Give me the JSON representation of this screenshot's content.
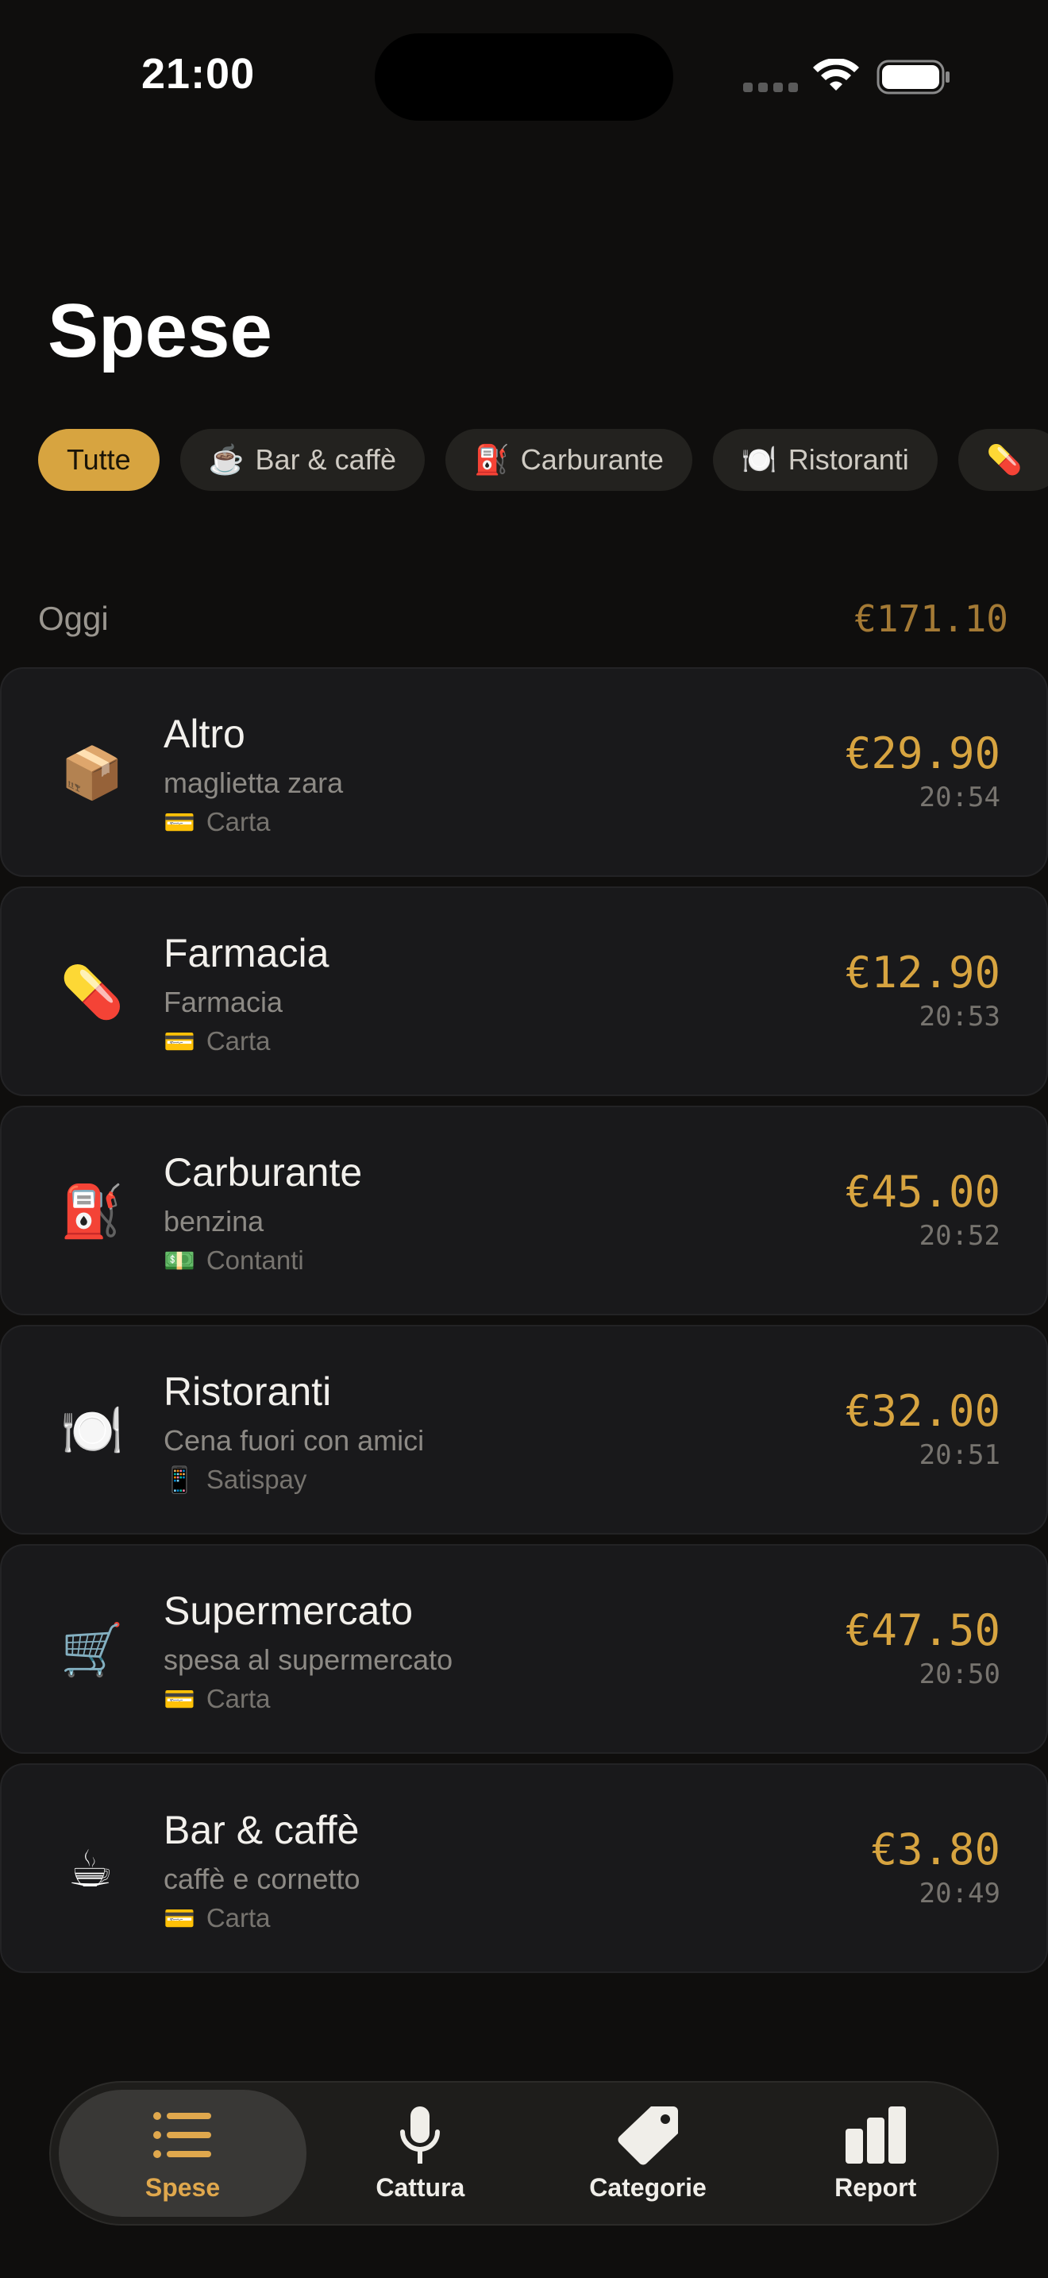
{
  "status_bar": {
    "time": "21:00"
  },
  "page": {
    "title": "Spese"
  },
  "filters": [
    {
      "label": "Tutte",
      "icon": "",
      "active": true
    },
    {
      "label": "Bar & caffè",
      "icon": "☕",
      "active": false
    },
    {
      "label": "Carburante",
      "icon": "⛽",
      "active": false
    },
    {
      "label": "Ristoranti",
      "icon": "🍽️",
      "active": false
    },
    {
      "label": "",
      "icon": "💊",
      "active": false
    }
  ],
  "section": {
    "title": "Oggi",
    "total": "€171.10"
  },
  "expenses": [
    {
      "icon": "📦",
      "category": "Altro",
      "note": "maglietta zara",
      "method_icon": "💳",
      "method": "Carta",
      "amount": "€29.90",
      "time": "20:54"
    },
    {
      "icon": "💊",
      "category": "Farmacia",
      "note": "Farmacia",
      "method_icon": "💳",
      "method": "Carta",
      "amount": "€12.90",
      "time": "20:53"
    },
    {
      "icon": "⛽",
      "category": "Carburante",
      "note": "benzina",
      "method_icon": "💵",
      "method": "Contanti",
      "amount": "€45.00",
      "time": "20:52"
    },
    {
      "icon": "🍽️",
      "category": "Ristoranti",
      "note": "Cena fuori con amici",
      "method_icon": "📱",
      "method": "Satispay",
      "amount": "€32.00",
      "time": "20:51"
    },
    {
      "icon": "🛒",
      "category": "Supermercato",
      "note": "spesa al supermercato",
      "method_icon": "💳",
      "method": "Carta",
      "amount": "€47.50",
      "time": "20:50"
    },
    {
      "icon": "☕",
      "category": "Bar & caffè",
      "note": "caffè e cornetto",
      "method_icon": "💳",
      "method": "Carta",
      "amount": "€3.80",
      "time": "20:49"
    }
  ],
  "tabs": [
    {
      "label": "Spese",
      "icon": "list-icon",
      "active": true
    },
    {
      "label": "Cattura",
      "icon": "microphone-icon",
      "active": false
    },
    {
      "label": "Categorie",
      "icon": "tag-icon",
      "active": false
    },
    {
      "label": "Report",
      "icon": "bar-chart-icon",
      "active": false
    }
  ],
  "colors": {
    "accent": "#d7a440",
    "background": "#0f0e0d",
    "card": "#19191b"
  }
}
